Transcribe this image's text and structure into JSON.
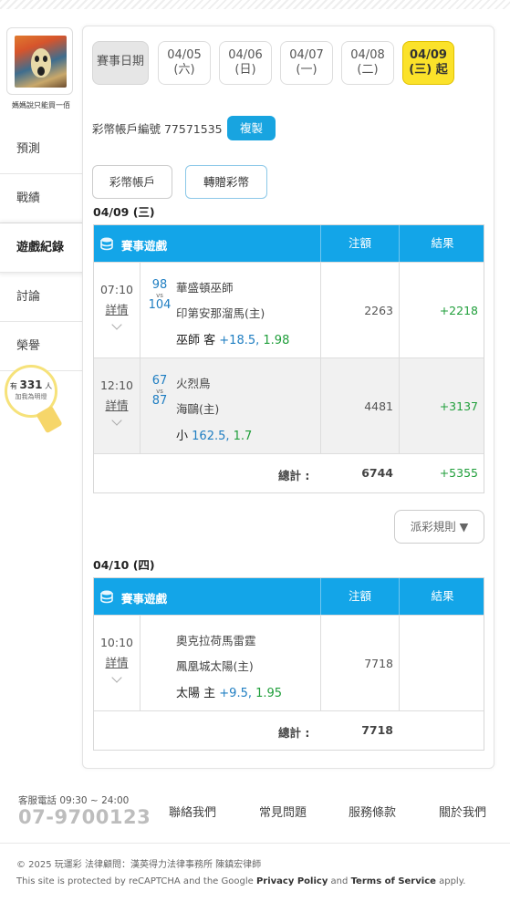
{
  "user": {
    "name": "媽媽說只能買一佰"
  },
  "nav": [
    {
      "label": "預測"
    },
    {
      "label": "戰績"
    },
    {
      "label": "遊戲紀錄"
    },
    {
      "label": "討論"
    },
    {
      "label": "榮譽"
    }
  ],
  "bulb": {
    "prefix": "有",
    "count": "331",
    "suffix": "人",
    "sub": "加我為明燈"
  },
  "dates": {
    "label": "賽事日期",
    "items": [
      {
        "date": "04/05",
        "day": "(六)"
      },
      {
        "date": "04/06",
        "day": "(日)"
      },
      {
        "date": "04/07",
        "day": "(一)"
      },
      {
        "date": "04/08",
        "day": "(二)"
      },
      {
        "date": "04/09",
        "day": "(三) 起"
      }
    ]
  },
  "account": {
    "text": "彩幣帳戶編號 77571535",
    "copy": "複製"
  },
  "tabs": {
    "coin_account": "彩幣帳戶",
    "transfer": "轉贈彩幣"
  },
  "table_headers": {
    "game": "賽事遊戲",
    "bet": "注額",
    "result": "結果"
  },
  "days": [
    {
      "title": "04/09 (三)",
      "rows": [
        {
          "time": "07:10",
          "detail": "詳情",
          "score_away": "98",
          "vs": "vs",
          "score_home": "104",
          "away": "華盛頓巫師",
          "home": "印第安那溜馬(主)",
          "pick_text": "巫師 客",
          "pick_line": "+18.5,",
          "pick_odds": "1.98",
          "bet": "2263",
          "result": "+2218"
        },
        {
          "time": "12:10",
          "detail": "詳情",
          "score_away": "67",
          "vs": "vs",
          "score_home": "87",
          "away": "火烈鳥",
          "home": "海鷗(主)",
          "pick_text": "小",
          "pick_line": "162.5,",
          "pick_odds": "1.7",
          "bet": "4481",
          "result": "+3137"
        }
      ],
      "total_label": "總計 :",
      "total_bet": "6744",
      "total_result": "+5355"
    },
    {
      "title": "04/10 (四)",
      "rows": [
        {
          "time": "10:10",
          "detail": "詳情",
          "score_away": "",
          "vs": "",
          "score_home": "",
          "away": "奧克拉荷馬雷霆",
          "home": "鳳凰城太陽(主)",
          "pick_text": "太陽 主",
          "pick_line": "+9.5,",
          "pick_odds": "1.95",
          "bet": "7718",
          "result": ""
        }
      ],
      "total_label": "總計 :",
      "total_bet": "7718",
      "total_result": ""
    }
  ],
  "rules_button": "派彩規則 ▼",
  "footer": {
    "service_label": "客服電話 09:30 ~ 24:00",
    "phone": "07-9700123",
    "links": [
      "聯絡我們",
      "常見問題",
      "服務條款",
      "關於我們"
    ],
    "copyright": "© 2025 玩運彩 法律顧問：漢英得力法律事務所 陳鎮宏律師",
    "recaptcha_pre": "This site is protected by reCAPTCHA and the Google",
    "privacy": "Privacy Policy",
    "and": "and",
    "terms": "Terms of Service",
    "apply": "apply."
  },
  "colors": {
    "accent": "#13a5e8",
    "active_date": "#fbe22a",
    "win": "#1f9e3a",
    "score": "#1f7ec2"
  }
}
